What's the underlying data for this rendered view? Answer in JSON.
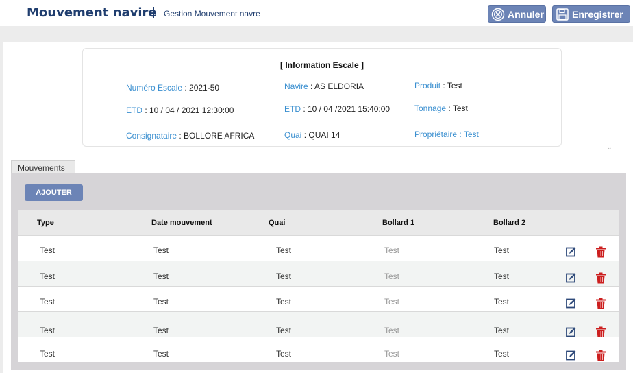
{
  "header": {
    "title": "Mouvement navire",
    "subtitle": "Gestion Mouvement navre",
    "annuler_label": "Annuler",
    "enregistrer_label": "Enregistrer"
  },
  "info": {
    "title": "[ Information Escale ]",
    "numero_escale_label": "Numéro  Escale",
    "numero_escale_value": " : 2021-50",
    "navire_label": "Navire",
    "navire_value": " : AS ELDORIA",
    "produit_label": "Produit",
    "produit_value": " : Test",
    "etd1_label": "ETD",
    "etd1_value": " : 10 / 04 / 2021   12:30:00",
    "etd2_label": "ETD",
    "etd2_value": " : 10 / 04 /2021   15:40:00",
    "tonnage_label": "Tonnage",
    "tonnage_value": " : Test",
    "consignataire_label": "Consignataire",
    "consignataire_value": " : BOLLORE AFRICA",
    "quai_label": "Quai",
    "quai_value": " : QUAI 14",
    "proprietaire_label": "Propriétaire : Test"
  },
  "tab_label": "Mouvements",
  "add_button_label": "AJOUTER",
  "table": {
    "headers": [
      "Type",
      "Date mouvement",
      "Quai",
      "Bollard 1",
      "Bollard 2"
    ],
    "rows": [
      [
        "Test",
        "Test",
        "Test",
        "Test",
        "Test"
      ],
      [
        "Test",
        "Test",
        "Test",
        "Test",
        "Test"
      ],
      [
        "Test",
        "Test",
        "Test",
        "Test",
        "Test"
      ],
      [
        "Test",
        "Test",
        "Test",
        "Test",
        "Test"
      ],
      [
        "Test",
        "Test",
        "Test",
        "Test",
        "Test"
      ]
    ]
  },
  "colors": {
    "brand": "#1f3d6e",
    "button": "#6c84b6",
    "label": "#3a8fd0",
    "delete": "#cc1f1f"
  }
}
